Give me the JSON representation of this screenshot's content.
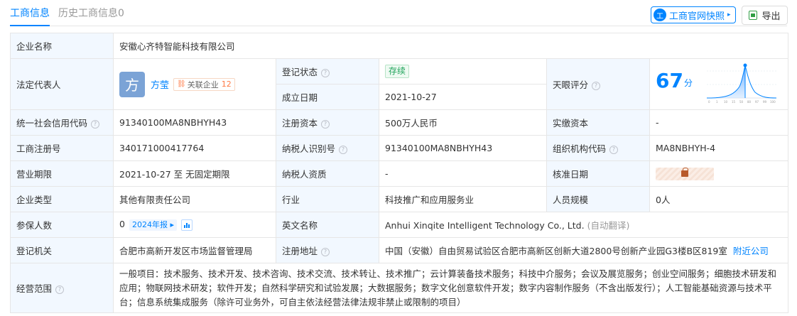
{
  "tabs": {
    "active": "工商信息",
    "history": "历史工商信息0"
  },
  "toolbar": {
    "snapshot_label": "工商官网快照",
    "snapshot_icon": "工",
    "export_label": "导出"
  },
  "rows": {
    "company_name": {
      "label": "企业名称",
      "value": "安徽心齐特智能科技有限公司"
    },
    "legal_rep": {
      "label": "法定代表人",
      "avatar_char": "方",
      "name": "方莹",
      "rel_label": "关联企业",
      "rel_count": "12"
    },
    "reg_status": {
      "label": "登记状态",
      "value": "存续"
    },
    "founded": {
      "label": "成立日期",
      "value": "2021-10-27"
    },
    "tianyan": {
      "label": "天眼评分",
      "score": "67",
      "unit": "分",
      "axis": [
        "0",
        "1",
        "10",
        "15",
        "50",
        "80",
        "97",
        "99",
        "100"
      ]
    },
    "credit_code": {
      "label": "统一社会信用代码",
      "value": "91340100MA8NBHYH43"
    },
    "reg_capital": {
      "label": "注册资本",
      "value": "500万人民币"
    },
    "paid_capital": {
      "label": "实缴资本",
      "value": "-"
    },
    "biz_reg_no": {
      "label": "工商注册号",
      "value": "340171000417764"
    },
    "taxpayer_id": {
      "label": "纳税人识别号",
      "value": "91340100MA8NBHYH43"
    },
    "org_code": {
      "label": "组织机构代码",
      "value": "MA8NBHYH-4"
    },
    "biz_term": {
      "label": "营业期限",
      "value": "2021-10-27 至 无固定期限"
    },
    "taxpayer_qual": {
      "label": "纳税人资质",
      "value": "-"
    },
    "approve_date": {
      "label": "核准日期"
    },
    "company_type": {
      "label": "企业类型",
      "value": "其他有限责任公司"
    },
    "industry": {
      "label": "行业",
      "value": "科技推广和应用服务业"
    },
    "staff_size": {
      "label": "人员规模",
      "value": "0人"
    },
    "insured": {
      "label": "参保人数",
      "value": "0",
      "report": "2024年报"
    },
    "english_name": {
      "label": "英文名称",
      "value": "Anhui Xinqite Intelligent Technology Co., Ltd.",
      "translate": "(自动翻译)"
    },
    "reg_authority": {
      "label": "登记机关",
      "value": "合肥市高新开发区市场监督管理局"
    },
    "reg_address": {
      "label": "注册地址",
      "value": "中国（安徽）自由贸易试验区合肥市高新区创新大道2800号创新产业园G3楼B区819室",
      "nearby": "附近公司"
    },
    "scope": {
      "label": "经营范围",
      "value": "一般项目：技术服务、技术开发、技术咨询、技术交流、技术转让、技术推广；云计算装备技术服务；科技中介服务；会议及展览服务；创业空间服务；细胞技术研发和应用；物联网技术研发；软件开发；自然科学研究和试验发展；大数据服务；数字文化创意软件开发；数字内容制作服务（不含出版发行）；人工智能基础资源与技术平台；信息系统集成服务（除许可业务外，可自主依法经营法律法规非禁止或限制的项目）"
    }
  },
  "colors": {
    "accent": "#0084ff",
    "label_bg": "#f2f8ff",
    "status_green": "#1fa35a"
  }
}
